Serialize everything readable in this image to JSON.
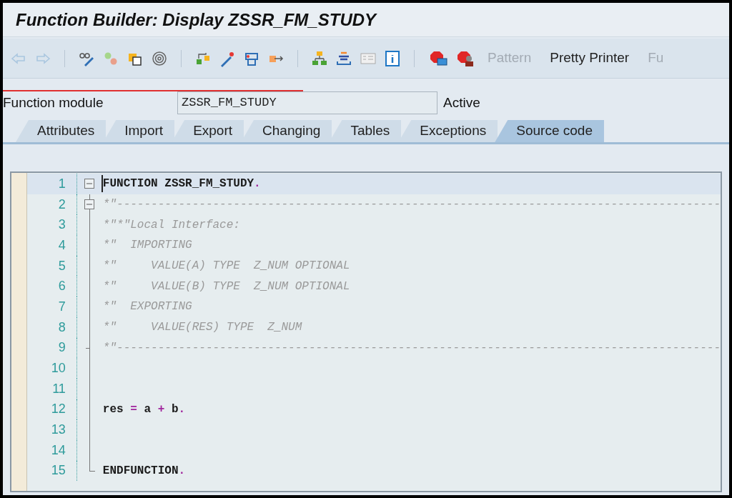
{
  "window": {
    "title": "Function Builder: Display ZSSR_FM_STUDY"
  },
  "toolbar": {
    "text_buttons": [
      {
        "label": "Pattern",
        "disabled": true
      },
      {
        "label": "Pretty Printer",
        "disabled": false
      },
      {
        "label": "Fu",
        "disabled": true
      }
    ]
  },
  "header": {
    "label": "Function module",
    "value": "ZSSR_FM_STUDY",
    "status": "Active"
  },
  "tabs": [
    {
      "label": "Attributes",
      "selected": false
    },
    {
      "label": "Import",
      "selected": false
    },
    {
      "label": "Export",
      "selected": false
    },
    {
      "label": "Changing",
      "selected": false
    },
    {
      "label": "Tables",
      "selected": false
    },
    {
      "label": "Exceptions",
      "selected": false
    },
    {
      "label": "Source code",
      "selected": true
    }
  ],
  "editor": {
    "lines": [
      {
        "number": "1",
        "kind": "toggle",
        "selected": true,
        "tokens": [
          {
            "kind": "code",
            "text": "FUNCTION ZSSR_FM_STUDY"
          },
          {
            "kind": "op",
            "text": "."
          }
        ]
      },
      {
        "number": "2",
        "kind": "toggleopen",
        "selected": false,
        "tokens": [
          {
            "kind": "comment",
            "text": "*\"----------------------------------------------------------------------------------------"
          }
        ]
      },
      {
        "number": "3",
        "kind": "line",
        "selected": false,
        "tokens": [
          {
            "kind": "comment",
            "text": "*\"*\"Local Interface:"
          }
        ]
      },
      {
        "number": "4",
        "kind": "line",
        "selected": false,
        "tokens": [
          {
            "kind": "comment",
            "text": "*\"  IMPORTING"
          }
        ]
      },
      {
        "number": "5",
        "kind": "line",
        "selected": false,
        "tokens": [
          {
            "kind": "comment",
            "text": "*\"     VALUE(A) TYPE  Z_NUM OPTIONAL"
          }
        ]
      },
      {
        "number": "6",
        "kind": "line",
        "selected": false,
        "tokens": [
          {
            "kind": "comment",
            "text": "*\"     VALUE(B) TYPE  Z_NUM OPTIONAL"
          }
        ]
      },
      {
        "number": "7",
        "kind": "line",
        "selected": false,
        "tokens": [
          {
            "kind": "comment",
            "text": "*\"  EXPORTING"
          }
        ]
      },
      {
        "number": "8",
        "kind": "line",
        "selected": false,
        "tokens": [
          {
            "kind": "comment",
            "text": "*\"     VALUE(RES) TYPE  Z_NUM"
          }
        ]
      },
      {
        "number": "9",
        "kind": "tick",
        "selected": false,
        "tokens": [
          {
            "kind": "comment",
            "text": "*\"----------------------------------------------------------------------------------------"
          }
        ]
      },
      {
        "number": "10",
        "kind": "line",
        "selected": false
      },
      {
        "number": "11",
        "kind": "line",
        "selected": false
      },
      {
        "number": "12",
        "kind": "line",
        "selected": false,
        "tokens": [
          {
            "kind": "code",
            "text": "res "
          },
          {
            "kind": "op",
            "text": "="
          },
          {
            "kind": "code",
            "text": " a "
          },
          {
            "kind": "op",
            "text": "+"
          },
          {
            "kind": "code",
            "text": " b"
          },
          {
            "kind": "op",
            "text": "."
          }
        ]
      },
      {
        "number": "13",
        "kind": "line",
        "selected": false
      },
      {
        "number": "14",
        "kind": "line",
        "selected": false
      },
      {
        "number": "15",
        "kind": "end",
        "selected": false,
        "tokens": [
          {
            "kind": "code",
            "text": "ENDFUNCTION"
          },
          {
            "kind": "op",
            "text": "."
          }
        ]
      }
    ]
  }
}
